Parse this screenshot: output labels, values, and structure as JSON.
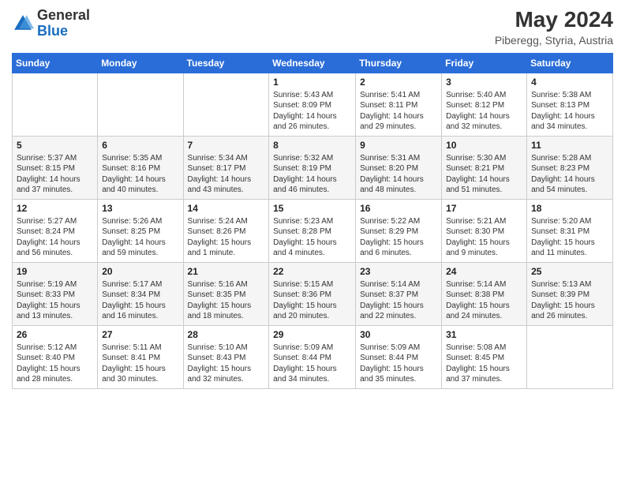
{
  "header": {
    "logo_general": "General",
    "logo_blue": "Blue",
    "month_year": "May 2024",
    "location": "Piberegg, Styria, Austria"
  },
  "weekdays": [
    "Sunday",
    "Monday",
    "Tuesday",
    "Wednesday",
    "Thursday",
    "Friday",
    "Saturday"
  ],
  "weeks": [
    [
      {
        "day": "",
        "info": ""
      },
      {
        "day": "",
        "info": ""
      },
      {
        "day": "",
        "info": ""
      },
      {
        "day": "1",
        "info": "Sunrise: 5:43 AM\nSunset: 8:09 PM\nDaylight: 14 hours\nand 26 minutes."
      },
      {
        "day": "2",
        "info": "Sunrise: 5:41 AM\nSunset: 8:11 PM\nDaylight: 14 hours\nand 29 minutes."
      },
      {
        "day": "3",
        "info": "Sunrise: 5:40 AM\nSunset: 8:12 PM\nDaylight: 14 hours\nand 32 minutes."
      },
      {
        "day": "4",
        "info": "Sunrise: 5:38 AM\nSunset: 8:13 PM\nDaylight: 14 hours\nand 34 minutes."
      }
    ],
    [
      {
        "day": "5",
        "info": "Sunrise: 5:37 AM\nSunset: 8:15 PM\nDaylight: 14 hours\nand 37 minutes."
      },
      {
        "day": "6",
        "info": "Sunrise: 5:35 AM\nSunset: 8:16 PM\nDaylight: 14 hours\nand 40 minutes."
      },
      {
        "day": "7",
        "info": "Sunrise: 5:34 AM\nSunset: 8:17 PM\nDaylight: 14 hours\nand 43 minutes."
      },
      {
        "day": "8",
        "info": "Sunrise: 5:32 AM\nSunset: 8:19 PM\nDaylight: 14 hours\nand 46 minutes."
      },
      {
        "day": "9",
        "info": "Sunrise: 5:31 AM\nSunset: 8:20 PM\nDaylight: 14 hours\nand 48 minutes."
      },
      {
        "day": "10",
        "info": "Sunrise: 5:30 AM\nSunset: 8:21 PM\nDaylight: 14 hours\nand 51 minutes."
      },
      {
        "day": "11",
        "info": "Sunrise: 5:28 AM\nSunset: 8:23 PM\nDaylight: 14 hours\nand 54 minutes."
      }
    ],
    [
      {
        "day": "12",
        "info": "Sunrise: 5:27 AM\nSunset: 8:24 PM\nDaylight: 14 hours\nand 56 minutes."
      },
      {
        "day": "13",
        "info": "Sunrise: 5:26 AM\nSunset: 8:25 PM\nDaylight: 14 hours\nand 59 minutes."
      },
      {
        "day": "14",
        "info": "Sunrise: 5:24 AM\nSunset: 8:26 PM\nDaylight: 15 hours\nand 1 minute."
      },
      {
        "day": "15",
        "info": "Sunrise: 5:23 AM\nSunset: 8:28 PM\nDaylight: 15 hours\nand 4 minutes."
      },
      {
        "day": "16",
        "info": "Sunrise: 5:22 AM\nSunset: 8:29 PM\nDaylight: 15 hours\nand 6 minutes."
      },
      {
        "day": "17",
        "info": "Sunrise: 5:21 AM\nSunset: 8:30 PM\nDaylight: 15 hours\nand 9 minutes."
      },
      {
        "day": "18",
        "info": "Sunrise: 5:20 AM\nSunset: 8:31 PM\nDaylight: 15 hours\nand 11 minutes."
      }
    ],
    [
      {
        "day": "19",
        "info": "Sunrise: 5:19 AM\nSunset: 8:33 PM\nDaylight: 15 hours\nand 13 minutes."
      },
      {
        "day": "20",
        "info": "Sunrise: 5:17 AM\nSunset: 8:34 PM\nDaylight: 15 hours\nand 16 minutes."
      },
      {
        "day": "21",
        "info": "Sunrise: 5:16 AM\nSunset: 8:35 PM\nDaylight: 15 hours\nand 18 minutes."
      },
      {
        "day": "22",
        "info": "Sunrise: 5:15 AM\nSunset: 8:36 PM\nDaylight: 15 hours\nand 20 minutes."
      },
      {
        "day": "23",
        "info": "Sunrise: 5:14 AM\nSunset: 8:37 PM\nDaylight: 15 hours\nand 22 minutes."
      },
      {
        "day": "24",
        "info": "Sunrise: 5:14 AM\nSunset: 8:38 PM\nDaylight: 15 hours\nand 24 minutes."
      },
      {
        "day": "25",
        "info": "Sunrise: 5:13 AM\nSunset: 8:39 PM\nDaylight: 15 hours\nand 26 minutes."
      }
    ],
    [
      {
        "day": "26",
        "info": "Sunrise: 5:12 AM\nSunset: 8:40 PM\nDaylight: 15 hours\nand 28 minutes."
      },
      {
        "day": "27",
        "info": "Sunrise: 5:11 AM\nSunset: 8:41 PM\nDaylight: 15 hours\nand 30 minutes."
      },
      {
        "day": "28",
        "info": "Sunrise: 5:10 AM\nSunset: 8:43 PM\nDaylight: 15 hours\nand 32 minutes."
      },
      {
        "day": "29",
        "info": "Sunrise: 5:09 AM\nSunset: 8:44 PM\nDaylight: 15 hours\nand 34 minutes."
      },
      {
        "day": "30",
        "info": "Sunrise: 5:09 AM\nSunset: 8:44 PM\nDaylight: 15 hours\nand 35 minutes."
      },
      {
        "day": "31",
        "info": "Sunrise: 5:08 AM\nSunset: 8:45 PM\nDaylight: 15 hours\nand 37 minutes."
      },
      {
        "day": "",
        "info": ""
      }
    ]
  ]
}
